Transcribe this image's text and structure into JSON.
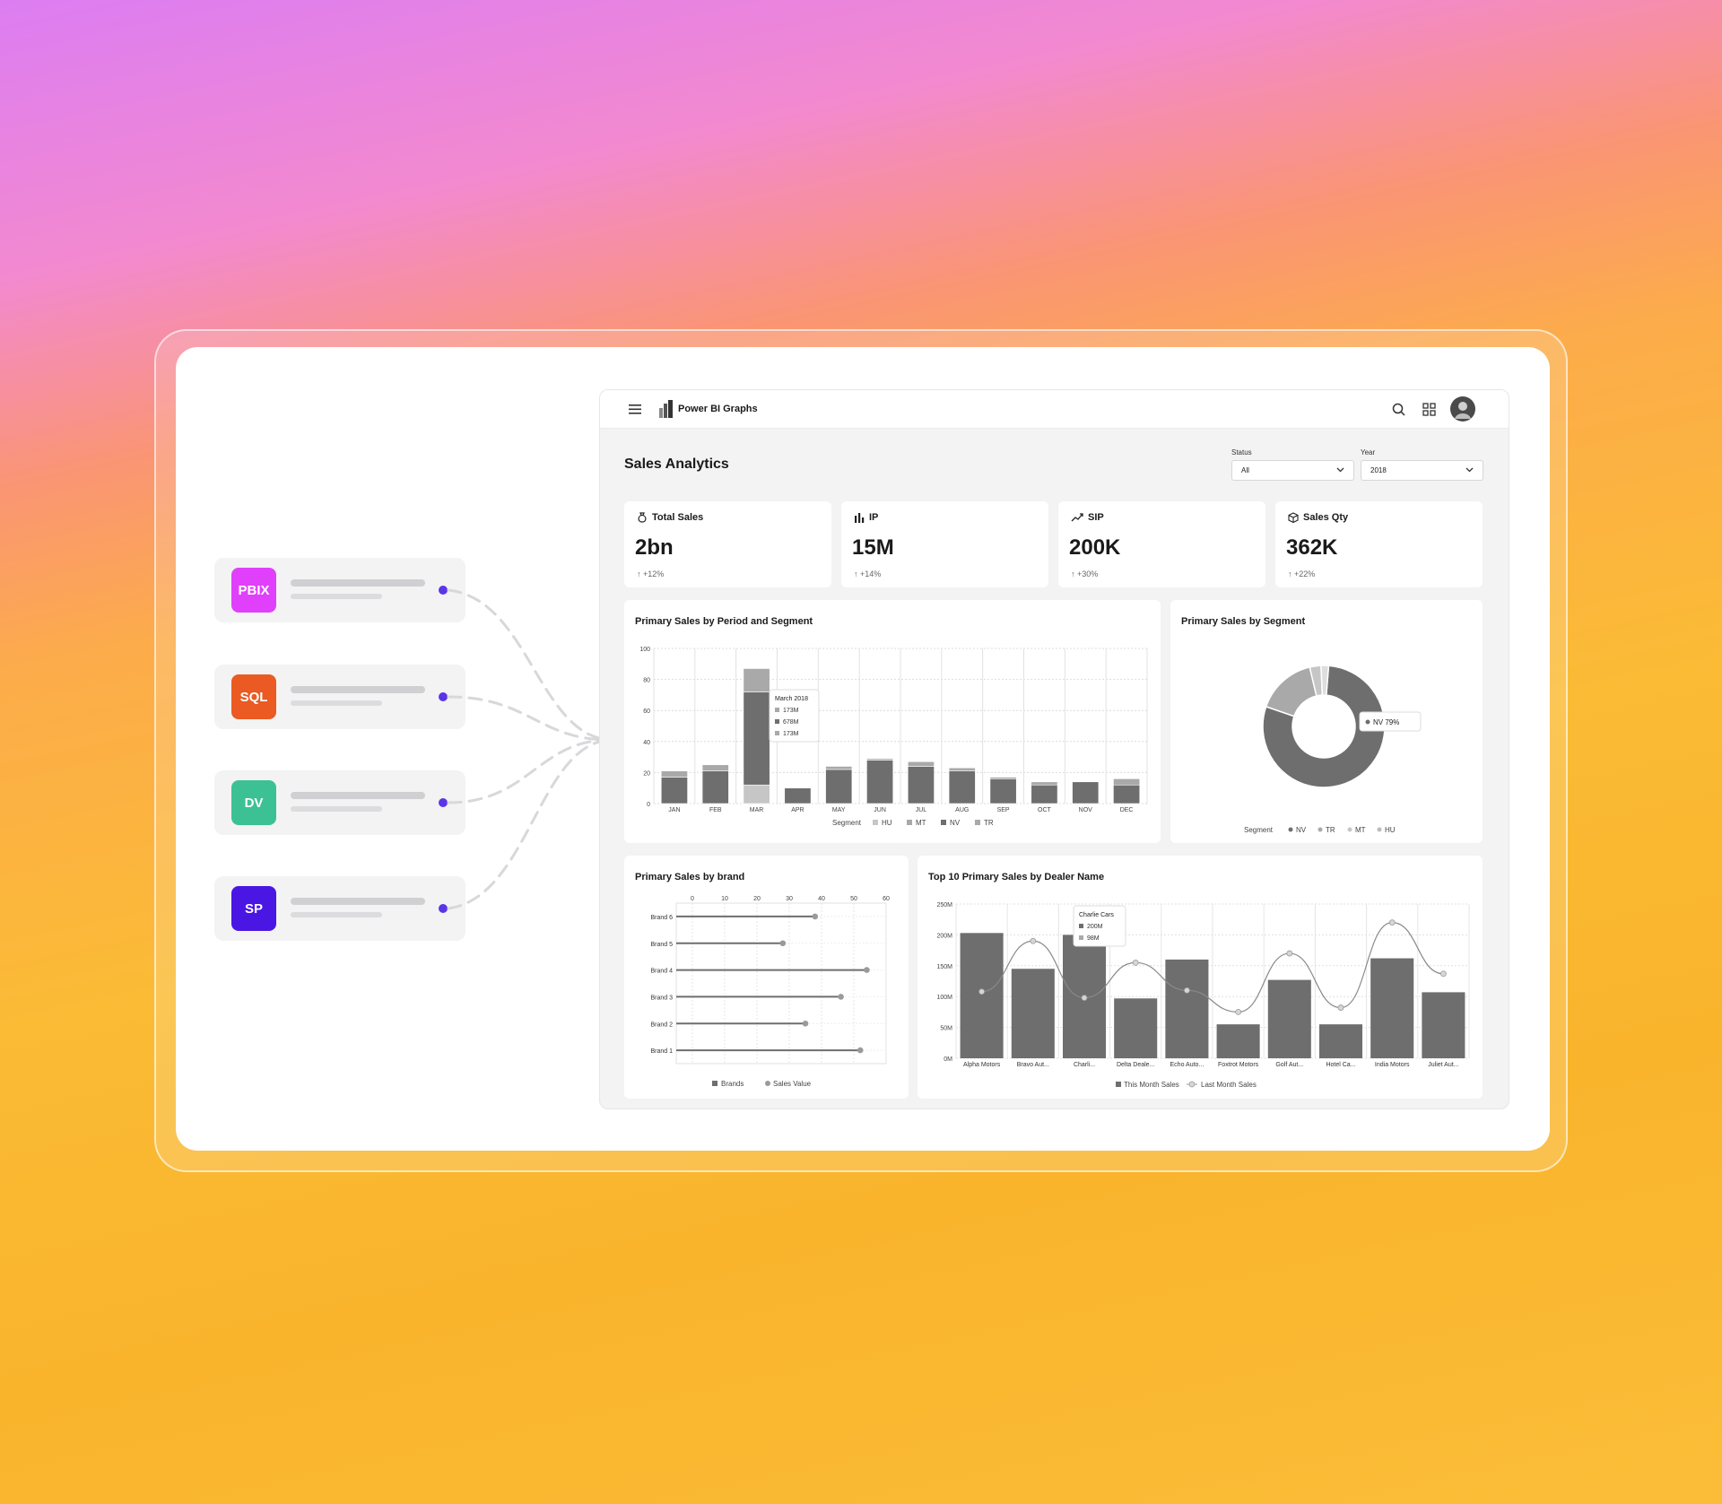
{
  "sources": [
    {
      "label": "PBIX",
      "color": "#e040fb"
    },
    {
      "label": "SQL",
      "color": "#ea5a22"
    },
    {
      "label": "DV",
      "color": "#3cc194"
    },
    {
      "label": "SP",
      "color": "#4a16e3"
    }
  ],
  "app": {
    "title": "Power BI Graphs"
  },
  "header": {
    "page_title": "Sales Analytics"
  },
  "filters": {
    "status": {
      "label": "Status",
      "value": "All"
    },
    "year": {
      "label": "Year",
      "value": "2018"
    }
  },
  "kpis": [
    {
      "title": "Total Sales",
      "value": "2bn",
      "delta": "+12%",
      "icon": "money-bag-icon"
    },
    {
      "title": "IP",
      "value": "15M",
      "delta": "+14%",
      "icon": "bar-chart-icon"
    },
    {
      "title": "SIP",
      "value": "200K",
      "delta": "+30%",
      "icon": "trend-up-icon"
    },
    {
      "title": "Sales Qty",
      "value": "362K",
      "delta": "+22%",
      "icon": "box-icon"
    }
  ],
  "colors": {
    "accent": "#5b35e8",
    "dark": "#6e6e6e",
    "mid": "#a9a9a9",
    "light": "#c6c6c6"
  },
  "chart_data": [
    {
      "type": "bar",
      "stacked": true,
      "title": "Primary Sales by Period and Segment",
      "categories": [
        "JAN",
        "FEB",
        "MAR",
        "APR",
        "MAY",
        "JUN",
        "JUL",
        "AUG",
        "SEP",
        "OCT",
        "NOV",
        "DEC"
      ],
      "ylim": [
        0,
        100
      ],
      "yticks": [
        0,
        20,
        40,
        60,
        80,
        100
      ],
      "series": [
        {
          "name": "HU",
          "values": [
            0,
            0,
            12,
            0,
            0,
            0,
            0,
            0,
            0,
            0,
            0,
            0
          ]
        },
        {
          "name": "MT",
          "values": [
            0,
            0,
            0,
            0,
            0,
            0,
            0,
            0,
            0,
            0,
            0,
            0
          ]
        },
        {
          "name": "NV",
          "values": [
            17,
            21,
            60,
            10,
            22,
            28,
            24,
            21,
            16,
            12,
            14,
            12
          ]
        },
        {
          "name": "TR",
          "values": [
            4,
            4,
            15,
            0,
            2,
            1,
            3,
            2,
            1,
            2,
            0,
            4
          ]
        }
      ],
      "legend_title": "Segment",
      "tooltip": {
        "title": "March 2018",
        "lines": [
          "173M",
          "678M",
          "173M"
        ]
      },
      "grid": true
    },
    {
      "type": "pie",
      "donut": true,
      "title": "Primary Sales by Segment",
      "labels": [
        "NV",
        "TR",
        "MT",
        "HU"
      ],
      "values": [
        79,
        16,
        3,
        2
      ],
      "legend_title": "Segment",
      "callout": "NV 79%"
    },
    {
      "type": "scatter",
      "subtype": "lollipop",
      "title": "Primary Sales by brand",
      "categories": [
        "Brand 6",
        "Brand 5",
        "Brand 4",
        "Brand 3",
        "Brand 2",
        "Brand 1"
      ],
      "values": [
        38,
        28,
        54,
        46,
        35,
        52
      ],
      "xticks": [
        0,
        10,
        20,
        30,
        40,
        50,
        60
      ],
      "xlim": [
        -5,
        60
      ],
      "legend": [
        "Brands",
        "Sales Value"
      ],
      "grid": true
    },
    {
      "type": "bar",
      "title": "Top 10 Primary Sales by Dealer Name",
      "categories": [
        "Alpha Motors",
        "Bravo Aut...",
        "Charli...",
        "Delta Deale...",
        "Echo Auto...",
        "Foxtrot Motors",
        "Golf Aut...",
        "Hotel Ca...",
        "India Motors",
        "Juliet Aut..."
      ],
      "yticks": [
        "0M",
        "50M",
        "100M",
        "150M",
        "200M",
        "250M"
      ],
      "ylim": [
        0,
        250
      ],
      "series": [
        {
          "name": "This Month Sales",
          "type": "bar",
          "values": [
            203,
            145,
            200,
            97,
            160,
            55,
            127,
            55,
            162,
            107
          ]
        },
        {
          "name": "Last Month Sales",
          "type": "line",
          "values": [
            108,
            190,
            98,
            155,
            110,
            75,
            170,
            82,
            220,
            137
          ]
        }
      ],
      "tooltip": {
        "title": "Charlie Cars",
        "lines": [
          "200M",
          "98M"
        ]
      },
      "grid": true
    }
  ]
}
